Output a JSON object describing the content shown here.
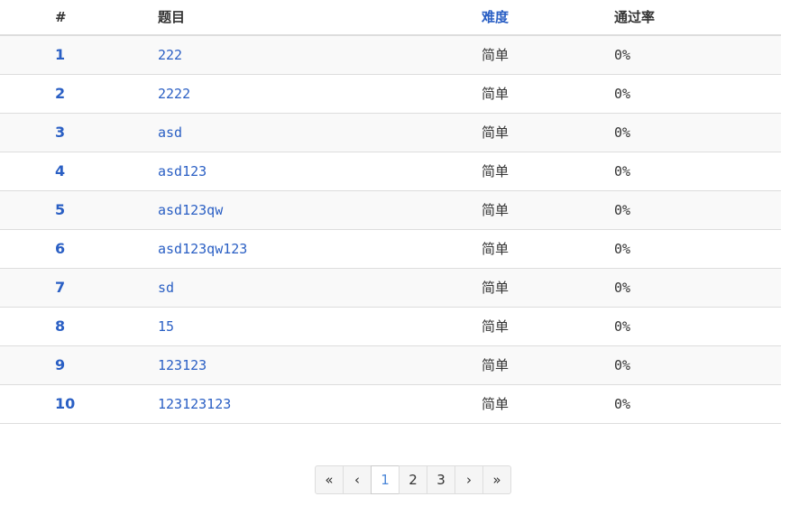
{
  "table": {
    "headers": {
      "num": "#",
      "title": "题目",
      "difficulty": "难度",
      "rate": "通过率"
    },
    "rows": [
      {
        "num": "1",
        "title": "222",
        "difficulty": "简单",
        "rate": "0%"
      },
      {
        "num": "2",
        "title": "2222",
        "difficulty": "简单",
        "rate": "0%"
      },
      {
        "num": "3",
        "title": "asd",
        "difficulty": "简单",
        "rate": "0%"
      },
      {
        "num": "4",
        "title": "asd123",
        "difficulty": "简单",
        "rate": "0%"
      },
      {
        "num": "5",
        "title": "asd123qw",
        "difficulty": "简单",
        "rate": "0%"
      },
      {
        "num": "6",
        "title": "asd123qw123",
        "difficulty": "简单",
        "rate": "0%"
      },
      {
        "num": "7",
        "title": "sd",
        "difficulty": "简单",
        "rate": "0%"
      },
      {
        "num": "8",
        "title": "15",
        "difficulty": "简单",
        "rate": "0%"
      },
      {
        "num": "9",
        "title": "123123",
        "difficulty": "简单",
        "rate": "0%"
      },
      {
        "num": "10",
        "title": "123123123",
        "difficulty": "简单",
        "rate": "0%"
      }
    ]
  },
  "pagination": {
    "first": "«",
    "prev": "‹",
    "pages": [
      "1",
      "2",
      "3"
    ],
    "current": "1",
    "next": "›",
    "last": "»"
  },
  "colors": {
    "link": "#2a5fc4",
    "active_page": "#4a86d8",
    "stripe": "#f9f9f9",
    "border": "#dddddd"
  }
}
